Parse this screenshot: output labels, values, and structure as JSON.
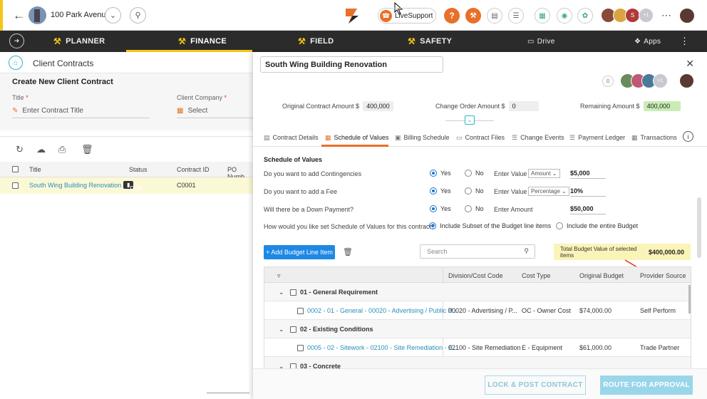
{
  "topbar": {
    "project_name": "100 Park Avenue",
    "live_support": "LiveSupport",
    "avatar_count": "+1"
  },
  "nav": {
    "planner": "PLANNER",
    "finance": "FINANCE",
    "field": "FIELD",
    "safety": "SAFETY",
    "drive": "Drive",
    "apps": "Apps"
  },
  "left": {
    "title": "Client Contracts",
    "create_title": "Create New Client Contract",
    "title_label": "Title",
    "title_placeholder": "Enter Contract Title",
    "company_label": "Client Company",
    "company_placeholder": "Select",
    "columns": [
      "Title",
      "Status",
      "Contract ID",
      "PO Numb"
    ],
    "rows": [
      {
        "title": "South Wing Building Renovation",
        "status": "Draft",
        "contract_id": "C0001"
      }
    ]
  },
  "modal": {
    "title": "South Wing Building Renovation",
    "avatar_count": "+1",
    "original_label": "Original Contract Amount $",
    "original_value": "400,000",
    "change_label": "Change Order Amount $",
    "change_value": "0",
    "remaining_label": "Remaining Amount $",
    "remaining_value": "400,000",
    "tabs": [
      "Contract Details",
      "Schedule of Values",
      "Billing Schedule",
      "Contract Files",
      "Change Events",
      "Payment Ledger",
      "Transactions"
    ],
    "sov": {
      "title": "Schedule of Values",
      "q1": "Do you want to add Contingencies",
      "q2": "Do you want to add a Fee",
      "q3": "Will there be a Down Payment?",
      "q4": "How would you like set Schedule of Values for this contract?",
      "yes": "Yes",
      "no": "No",
      "enter_value": "Enter Value",
      "enter_amount": "Enter Amount",
      "sel1": "Amount",
      "sel2": "Percentage",
      "v1": "$5,000",
      "v2": "10%",
      "v3": "$50,000",
      "opt1": "Include Subset of the Budget line items",
      "opt2": "Include the entire Budget",
      "add_btn": "+ Add Budget Line Item",
      "search_placeholder": "Search",
      "budget_label": "Total Budget Value of selected items",
      "budget_value": "$400,000.00",
      "grid_cols": [
        "Division/Cost Code",
        "Cost Type",
        "Original Budget",
        "Provider Source"
      ],
      "groups": [
        {
          "label": "01 - General Requirement",
          "item": "0002 - 01 - General - 00020 - Advertising / Public R...",
          "code": "00020 - Advertising / P...",
          "type": "OC - Owner Cost",
          "budget": "$74,000.00",
          "source": "Self Perform"
        },
        {
          "label": "02 - Existing Conditions",
          "item": "0005 - 02 - Sitework - 02100 - Site Remediation - E...",
          "code": "02100 - Site Remediation",
          "type": "E - Equipment",
          "budget": "$61,000.00",
          "source": "Trade Partner"
        },
        {
          "label": "03 - Concrete"
        }
      ]
    },
    "lock_btn": "LOCK & POST CONTRACT",
    "route_btn": "ROUTE FOR APPROVAL"
  },
  "colors": {
    "accent_yellow": "#f5c518",
    "accent_orange": "#e8702a",
    "link_blue": "#2a8fb8",
    "primary_blue": "#1e88e5"
  }
}
